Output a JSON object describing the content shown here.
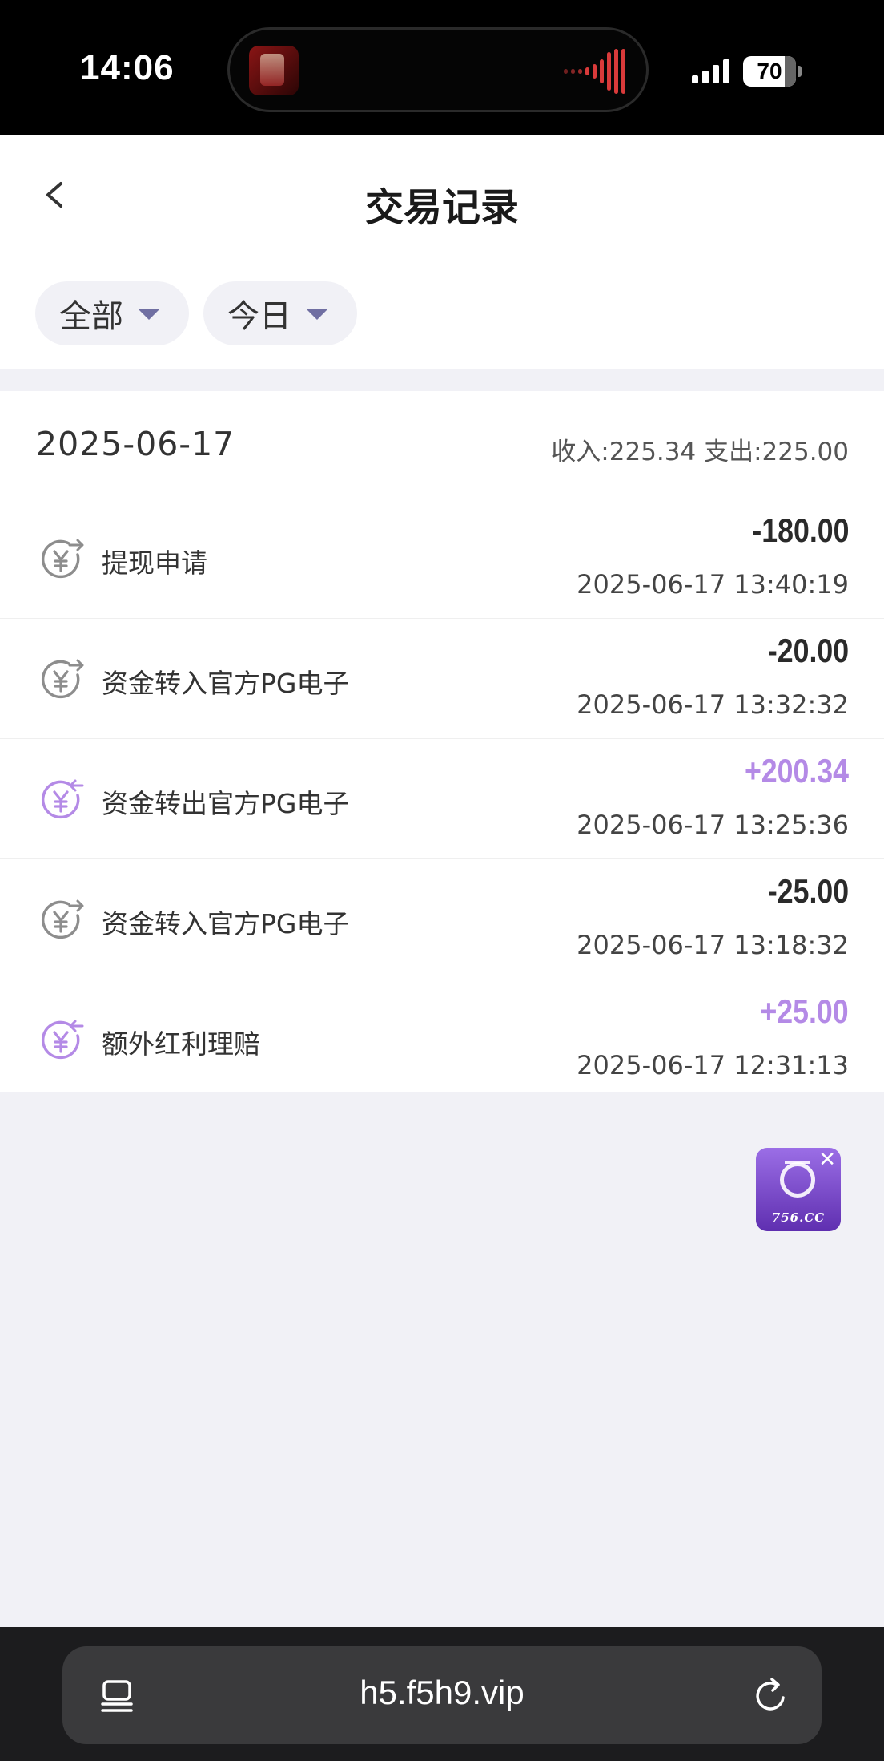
{
  "status_bar": {
    "time": "14:06",
    "battery": "70"
  },
  "header": {
    "title": "交易记录",
    "back_icon": "chevron-left-icon"
  },
  "filters": [
    {
      "label": "全部"
    },
    {
      "label": "今日"
    }
  ],
  "group": {
    "date": "2025-06-17",
    "summary": "收入:225.34 支出:225.00"
  },
  "transactions": [
    {
      "name": "提现申请",
      "amount": "-180.00",
      "time": "2025-06-17 13:40:19",
      "direction": "out"
    },
    {
      "name": "资金转入官方PG电子",
      "amount": "-20.00",
      "time": "2025-06-17 13:32:32",
      "direction": "out"
    },
    {
      "name": "资金转出官方PG电子",
      "amount": "+200.34",
      "time": "2025-06-17 13:25:36",
      "direction": "in"
    },
    {
      "name": "资金转入官方PG电子",
      "amount": "-25.00",
      "time": "2025-06-17 13:18:32",
      "direction": "out"
    },
    {
      "name": "额外红利理赔",
      "amount": "+25.00",
      "time": "2025-06-17 12:31:13",
      "direction": "in"
    }
  ],
  "floating_badge": {
    "text": "756.CC"
  },
  "browser": {
    "url": "h5.f5h9.vip"
  },
  "colors": {
    "positive": "#b48ae6",
    "negative": "#2a2a2a",
    "icon_out": "#8d8d8d",
    "icon_in": "#b48ae6"
  }
}
